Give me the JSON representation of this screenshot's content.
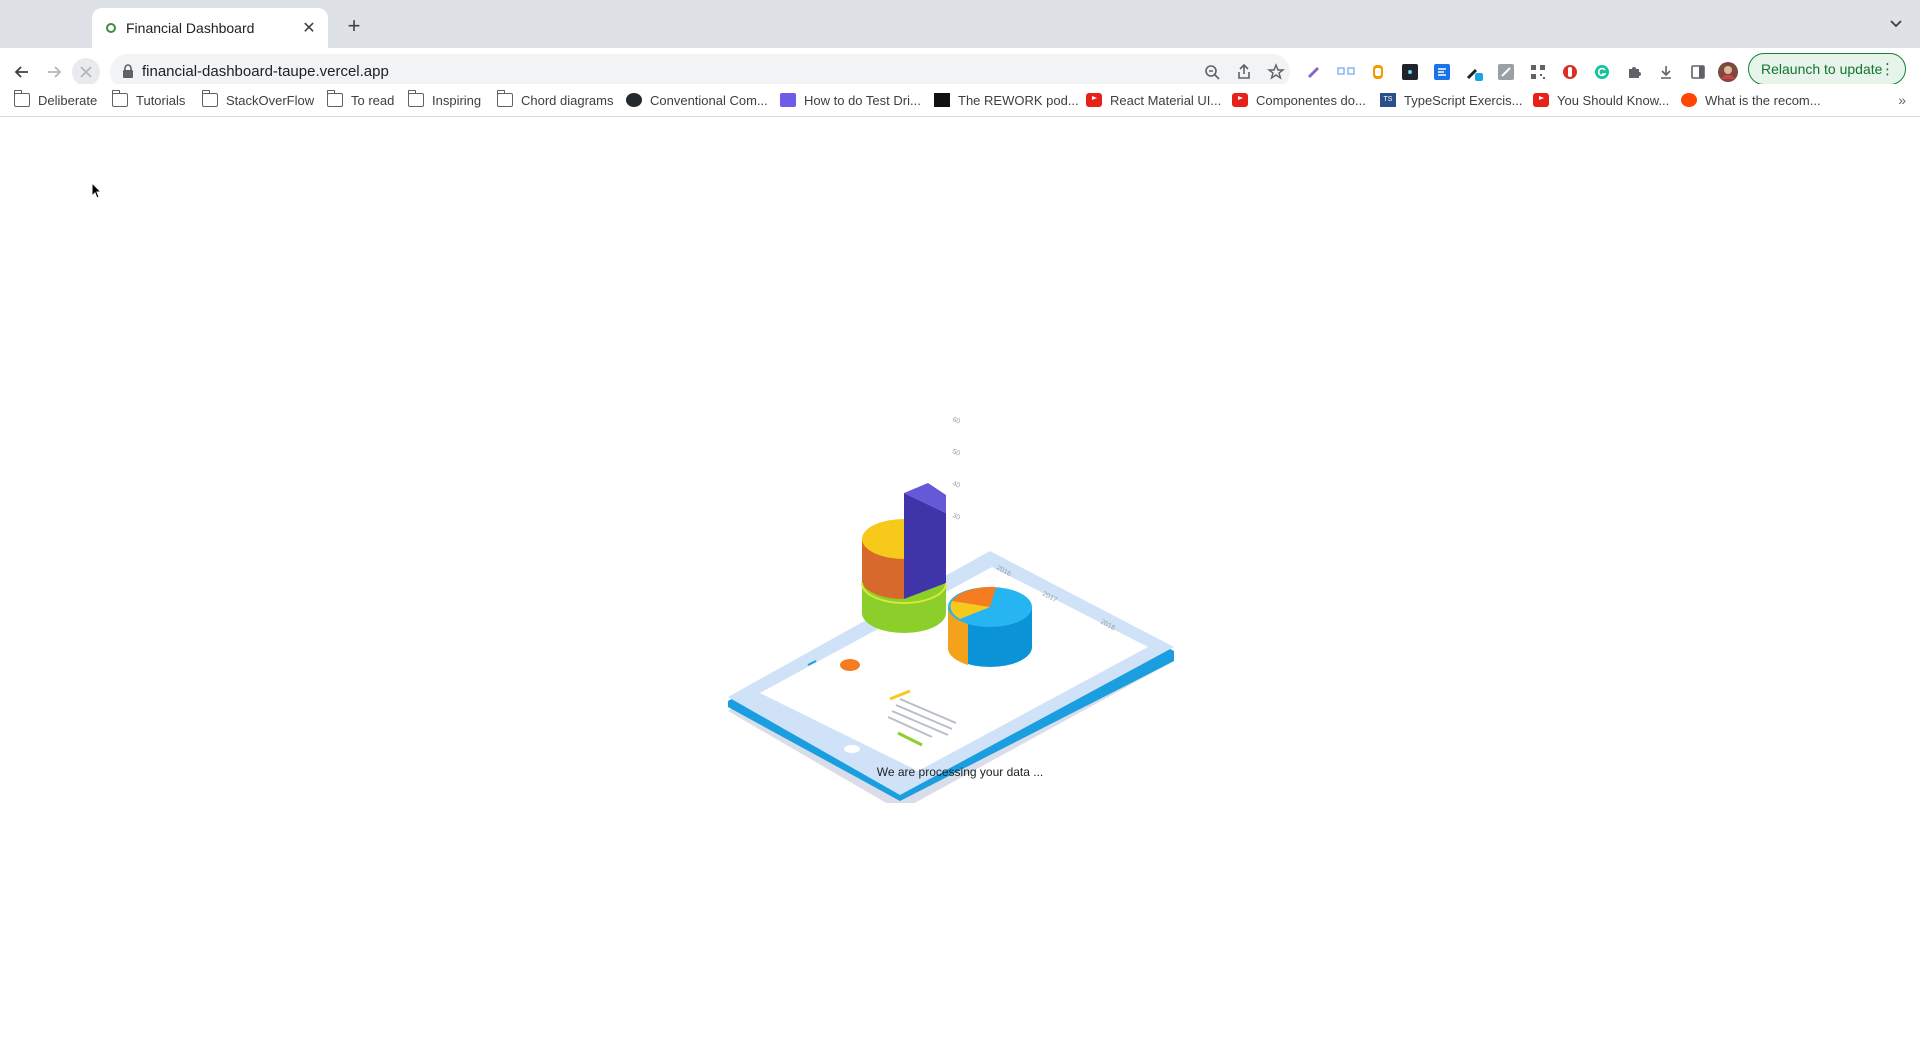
{
  "browser": {
    "tab": {
      "title": "Financial Dashboard",
      "close_glyph": "✕"
    },
    "new_tab_glyph": "+",
    "url": "financial-dashboard-taupe.vercel.app",
    "relaunch_label": "Relaunch to update",
    "relaunch_menu_glyph": "⋮"
  },
  "bookmarks": [
    {
      "label": "Deliberate",
      "icon": "folder-icon"
    },
    {
      "label": "Tutorials",
      "icon": "folder-icon"
    },
    {
      "label": "StackOverFlow",
      "icon": "folder-icon"
    },
    {
      "label": "To read",
      "icon": "folder-icon"
    },
    {
      "label": "Inspiring",
      "icon": "folder-icon"
    },
    {
      "label": "Chord diagrams",
      "icon": "folder-icon"
    },
    {
      "label": "Conventional Com...",
      "icon": "github-icon"
    },
    {
      "label": "How to do Test Dri...",
      "icon": "purple-site-icon"
    },
    {
      "label": "The REWORK pod...",
      "icon": "rework-icon"
    },
    {
      "label": "React Material UI...",
      "icon": "youtube-icon"
    },
    {
      "label": "Componentes do...",
      "icon": "youtube-icon"
    },
    {
      "label": "TypeScript Exercis...",
      "icon": "typescript-icon"
    },
    {
      "label": "You Should Know...",
      "icon": "youtube-icon"
    },
    {
      "label": "What is the recom...",
      "icon": "reddit-icon"
    }
  ],
  "bookmarks_overflow_glyph": "»",
  "page": {
    "loading_message": "We are processing your data ...",
    "illustration": {
      "axis_ticks": [
        "60",
        "50",
        "40",
        "30"
      ],
      "year_labels": [
        "2016",
        "2017",
        "2018"
      ]
    }
  },
  "colors": {
    "tabstrip": "#dee1e6",
    "omnibox": "#f1f3f4",
    "relaunch_border": "#188038",
    "tablet_edge": "#1a9ee0",
    "tablet_body": "#cfe2f7"
  }
}
